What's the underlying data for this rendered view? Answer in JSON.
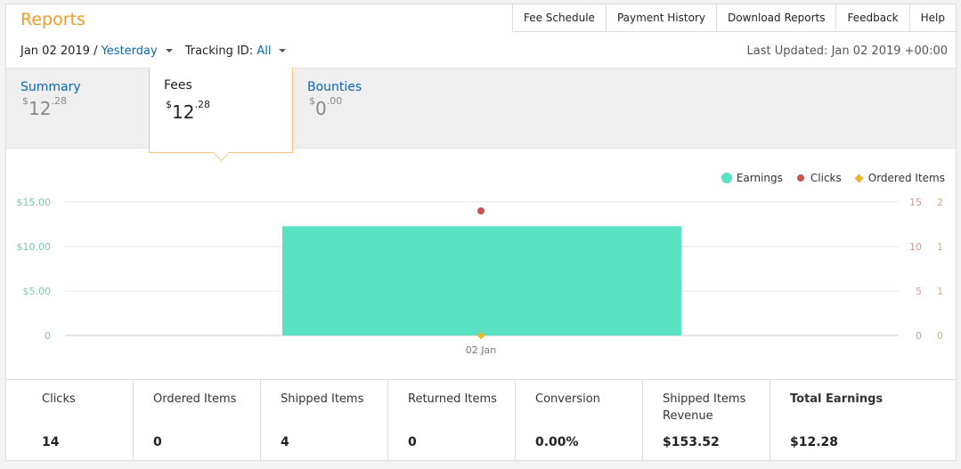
{
  "header": {
    "title": "Reports",
    "nav": [
      "Fee Schedule",
      "Payment History",
      "Download Reports",
      "Feedback",
      "Help"
    ]
  },
  "filters": {
    "date": "Jan 02 2019 /",
    "range": "Yesterday",
    "tracking_label": "Tracking ID:",
    "tracking_value": "All"
  },
  "last_updated": "Last Updated: Jan 02 2019 +00:00",
  "tabs": [
    {
      "label": "Summary",
      "currency": "$",
      "whole": "12",
      "cents": ".28"
    },
    {
      "label": "Fees",
      "currency": "$",
      "whole": "12",
      "cents": ".28"
    },
    {
      "label": "Bounties",
      "currency": "$",
      "whole": "0",
      "cents": ".00"
    }
  ],
  "legend": [
    "Earnings",
    "Clicks",
    "Ordered Items"
  ],
  "colors": {
    "earnings": "#58e2c2",
    "clicks": "#c9534f",
    "ordered": "#f0b429",
    "accent": "#f39a1f",
    "link": "#0a66b7"
  },
  "chart_data": {
    "type": "bar",
    "categories": [
      "02 Jan"
    ],
    "series": [
      {
        "name": "Earnings",
        "values": [
          12.28
        ],
        "axis": "left"
      },
      {
        "name": "Clicks",
        "values": [
          14
        ],
        "axis": "right1"
      },
      {
        "name": "Ordered Items",
        "values": [
          0
        ],
        "axis": "right2"
      }
    ],
    "y_left_ticks": [
      "$15.00",
      "$10.00",
      "$5.00",
      "0"
    ],
    "y_right1_ticks": [
      "15",
      "10",
      "5",
      "0"
    ],
    "y_right2_ticks": [
      "2",
      "1",
      "1",
      "0"
    ],
    "ylim_left": [
      0,
      15
    ],
    "ylim_right1": [
      0,
      15
    ],
    "ylim_right2": [
      0,
      2
    ],
    "grid": true,
    "legend_position": "top-right"
  },
  "stats": [
    {
      "label": "Clicks",
      "value": "14"
    },
    {
      "label": "Ordered Items",
      "value": "0"
    },
    {
      "label": "Shipped Items",
      "value": "4"
    },
    {
      "label": "Returned Items",
      "value": "0"
    },
    {
      "label": "Conversion",
      "value": "0.00%"
    },
    {
      "label": "Shipped Items Revenue",
      "value": "$153.52"
    },
    {
      "label": "Total Earnings",
      "value": "$12.28"
    }
  ]
}
